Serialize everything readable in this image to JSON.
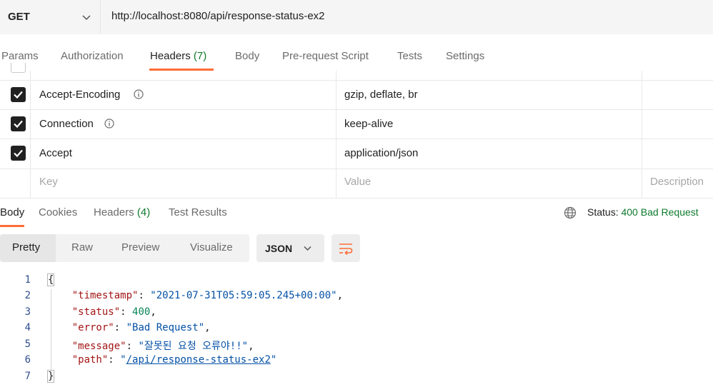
{
  "request": {
    "method": "GET",
    "url": "http://localhost:8080/api/response-status-ex2"
  },
  "request_tabs": {
    "params": "Params",
    "authorization": "Authorization",
    "headers": "Headers",
    "headers_count": "(7)",
    "body": "Body",
    "prerequest": "Pre-request Script",
    "tests": "Tests",
    "settings": "Settings"
  },
  "headers_table": {
    "rows": [
      {
        "key": "Accept-Encoding",
        "value": "gzip, deflate, br",
        "checked": true
      },
      {
        "key": "Connection",
        "value": "keep-alive",
        "checked": true
      },
      {
        "key": "Accept",
        "value": "application/json",
        "checked": false
      }
    ],
    "key_placeholder": "Key",
    "value_placeholder": "Value",
    "description_placeholder": "Description"
  },
  "response_tabs": {
    "body": "Body",
    "cookies": "Cookies",
    "headers": "Headers",
    "headers_count": "(4)",
    "test_results": "Test Results"
  },
  "status": {
    "label": "Status:",
    "value": "400 Bad Request",
    "color": "#0f7a2e"
  },
  "view_modes": {
    "pretty": "Pretty",
    "raw": "Raw",
    "preview": "Preview",
    "visualize": "Visualize",
    "selected": "Pretty"
  },
  "format": {
    "selected": "JSON"
  },
  "icons": {
    "method_dropdown": "chevron-down-icon",
    "info": "info-icon",
    "globe": "globe-icon",
    "format_dropdown": "chevron-down-icon",
    "wrap": "wrap-lines-icon",
    "checkbox": "checkmark-icon"
  },
  "accent_color": "#ff6c37",
  "response_body": {
    "line_numbers": [
      "1",
      "2",
      "3",
      "4",
      "5",
      "6",
      "7"
    ],
    "open_brace": "{",
    "close_brace": "}",
    "fields": [
      {
        "key": "\"timestamp\"",
        "value": "\"2021-07-31T05:59:05.245+00:00\"",
        "trail": ","
      },
      {
        "key": "\"status\"",
        "value": "400",
        "trail": ","
      },
      {
        "key": "\"error\"",
        "value": "\"Bad Request\"",
        "trail": ","
      },
      {
        "key": "\"message\"",
        "value": "\"잘못된 요청 오류야!!\"",
        "trail": ","
      },
      {
        "key": "\"path\"",
        "value_open": "\"",
        "value_link": "/api/response-status-ex2",
        "value_close": "\"",
        "trail": ""
      }
    ]
  }
}
